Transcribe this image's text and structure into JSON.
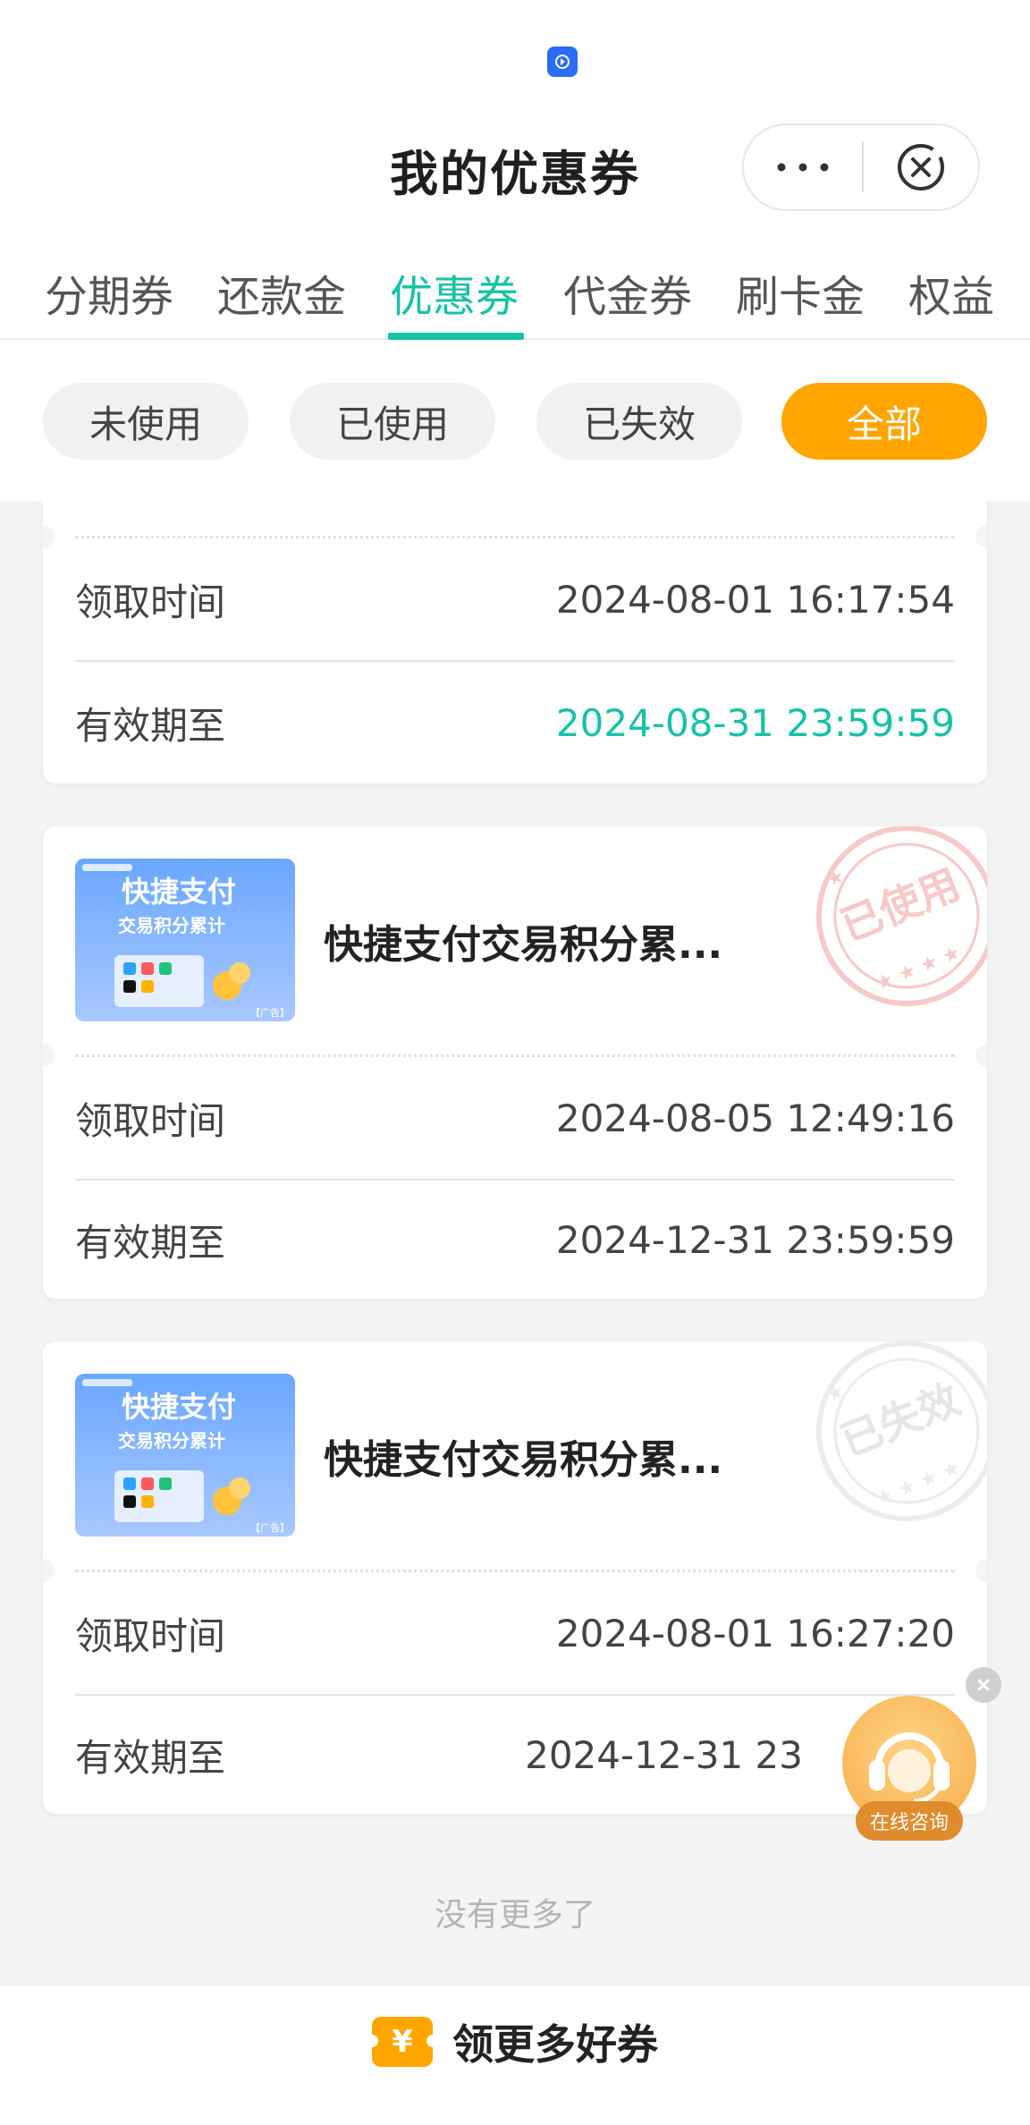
{
  "header": {
    "title": "我的优惠券",
    "more_icon": "more-dots-icon",
    "close_icon": "close-circle-icon"
  },
  "tabs": [
    {
      "label": "分期券",
      "active": false
    },
    {
      "label": "还款金",
      "active": false
    },
    {
      "label": "优惠券",
      "active": true
    },
    {
      "label": "代金券",
      "active": false
    },
    {
      "label": "刷卡金",
      "active": false
    },
    {
      "label": "权益",
      "active": false
    }
  ],
  "filters": [
    {
      "label": "未使用",
      "active": false
    },
    {
      "label": "已使用",
      "active": false
    },
    {
      "label": "已失效",
      "active": false
    },
    {
      "label": "全部",
      "active": true
    }
  ],
  "cards": [
    {
      "claim_label": "领取时间",
      "claim_time": "2024-08-01 16:17:54",
      "expire_label": "有效期至",
      "expire_time": "2024-08-31 23:59:59"
    },
    {
      "title": "快捷支付交易积分累...",
      "thumb_line1": "快捷支付",
      "thumb_line2": "交易积分累计",
      "thumb_ad": "【广告】",
      "stamp": "已使用",
      "claim_label": "领取时间",
      "claim_time": "2024-08-05 12:49:16",
      "expire_label": "有效期至",
      "expire_time": "2024-12-31 23:59:59"
    },
    {
      "title": "快捷支付交易积分累...",
      "thumb_line1": "快捷支付",
      "thumb_line2": "交易积分累计",
      "thumb_ad": "【广告】",
      "stamp": "已失效",
      "claim_label": "领取时间",
      "claim_time": "2024-08-01 16:27:20",
      "expire_label": "有效期至",
      "expire_time": "2024-12-31 23"
    }
  ],
  "no_more": "没有更多了",
  "consult": {
    "label": "在线咨询"
  },
  "bottom": {
    "yen": "¥",
    "label": "领更多好券"
  },
  "colors": {
    "accent": "#17c2a7",
    "orange": "#ffa500"
  }
}
